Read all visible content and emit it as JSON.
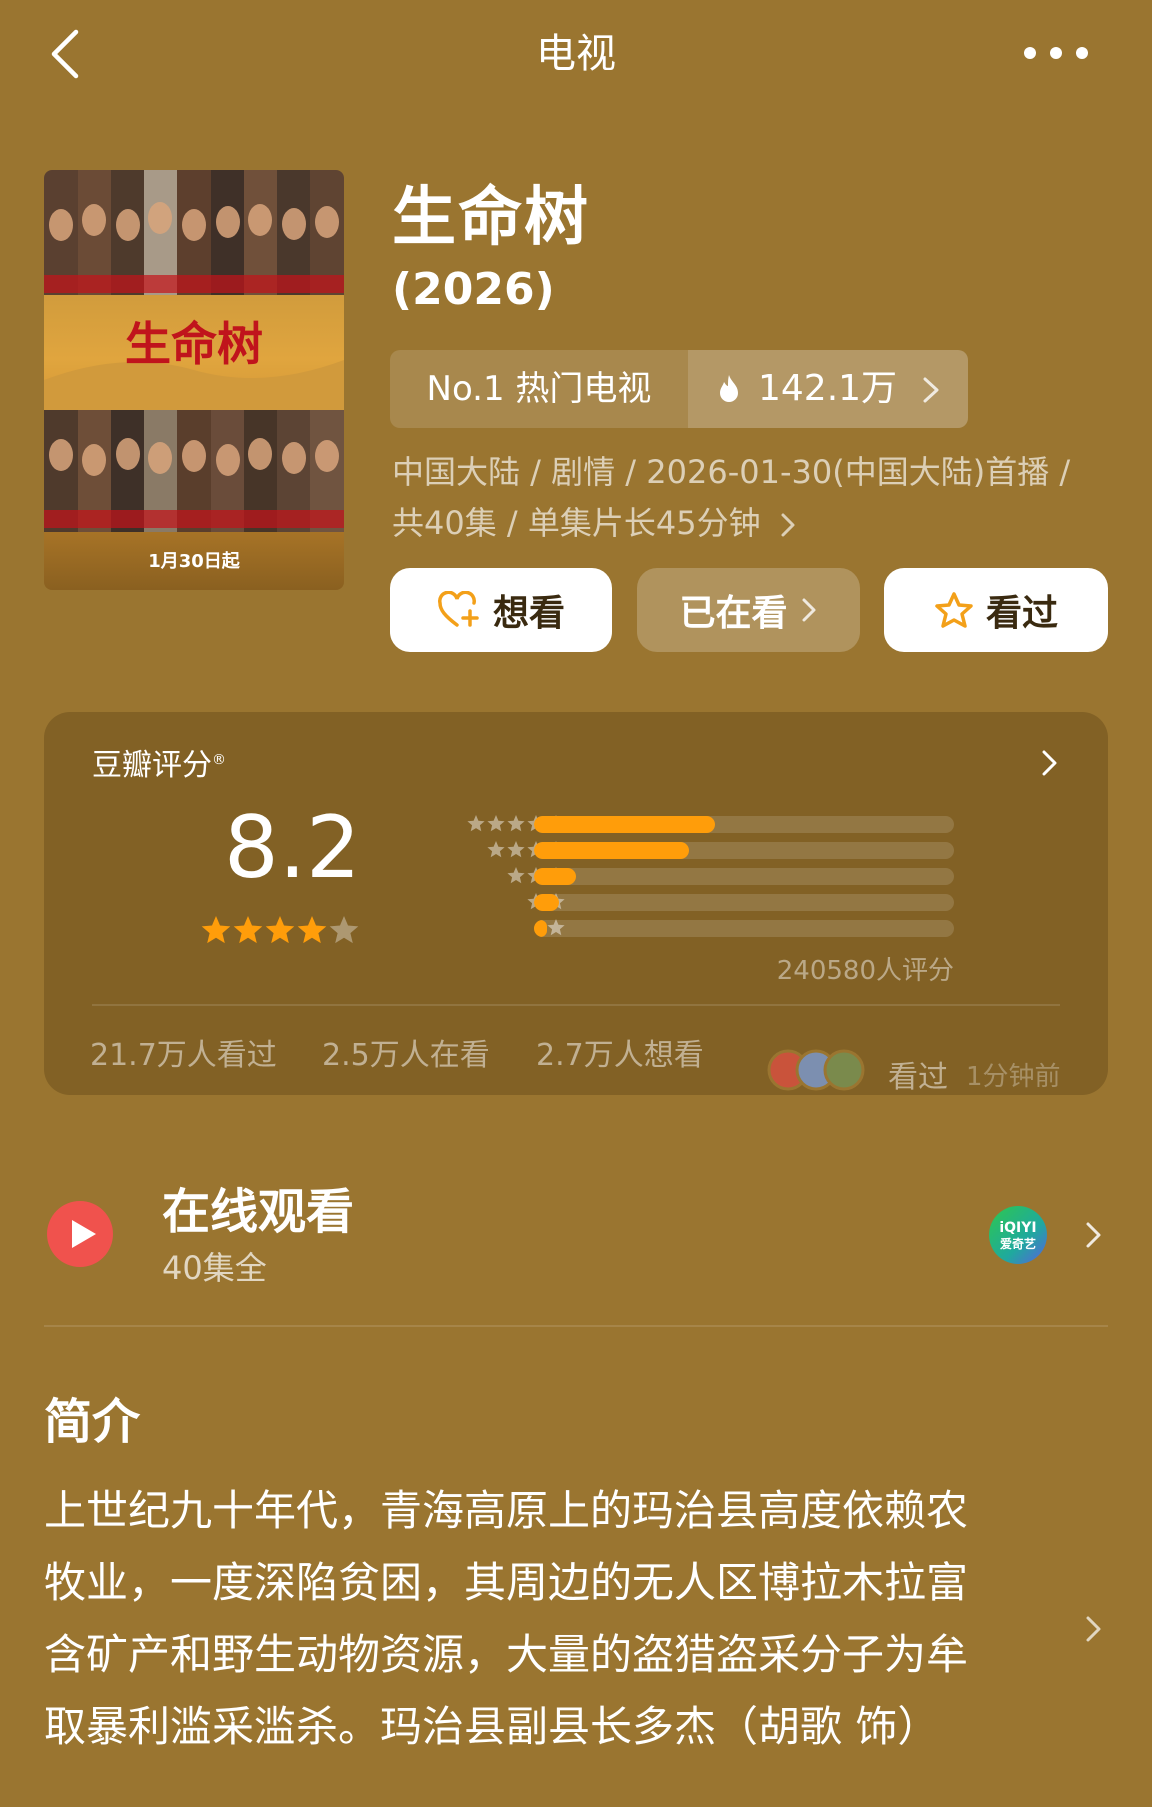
{
  "header": {
    "back_icon": "chevron-left-icon",
    "title": "电视",
    "more_icon": "more-dots-icon"
  },
  "poster": {
    "title_art": "生命树",
    "date_text": "1月30日起"
  },
  "show": {
    "title": "生命树",
    "year": "(2026)",
    "rank_label": "No.1 热门电视",
    "heat_icon": "fire-icon",
    "heat_value": "142.1万",
    "meta_line1": "中国大陆 / 剧情 / 2026-01-30(中国大陆)首播 /",
    "meta_line2": "共40集 / 单集片长45分钟"
  },
  "actions": {
    "want_label": "想看",
    "watching_label": "已在看",
    "seen_label": "看过"
  },
  "rating": {
    "label": "豆瓣评分",
    "reg_mark": "®",
    "score": "8.2",
    "star_count": 4,
    "distribution": [
      {
        "stars": 5,
        "fraction": 0.43
      },
      {
        "stars": 4,
        "fraction": 0.37
      },
      {
        "stars": 3,
        "fraction": 0.1
      },
      {
        "stars": 2,
        "fraction": 0.06
      },
      {
        "stars": 1,
        "fraction": 0.03
      }
    ],
    "votes": "240580人评分",
    "stats": {
      "seen": "21.7万人看过",
      "watching": "2.5万人在看",
      "want": "2.7万人想看"
    },
    "activity_label": "看过",
    "activity_time": "1分钟前"
  },
  "online": {
    "title": "在线观看",
    "subtitle": "40集全",
    "platform_text": "iQIYI 爱奇艺",
    "platform_line1": "iQIYI",
    "platform_line2": "爱奇艺"
  },
  "intro": {
    "title": "简介",
    "lines": [
      "上世纪九十年代，青海高原上的玛治县高度依赖农",
      "牧业，一度深陷贫困，其周边的无人区博拉木拉富",
      "含矿产和野生动物资源，大量的盗猎盗采分子为牟",
      "取暴利滥采滥杀。玛治县副县长多杰（胡歌 饰）"
    ]
  },
  "colors": {
    "background": "#9a7530",
    "accent_orange": "#ff9d0a",
    "play_red": "#f0524d"
  }
}
